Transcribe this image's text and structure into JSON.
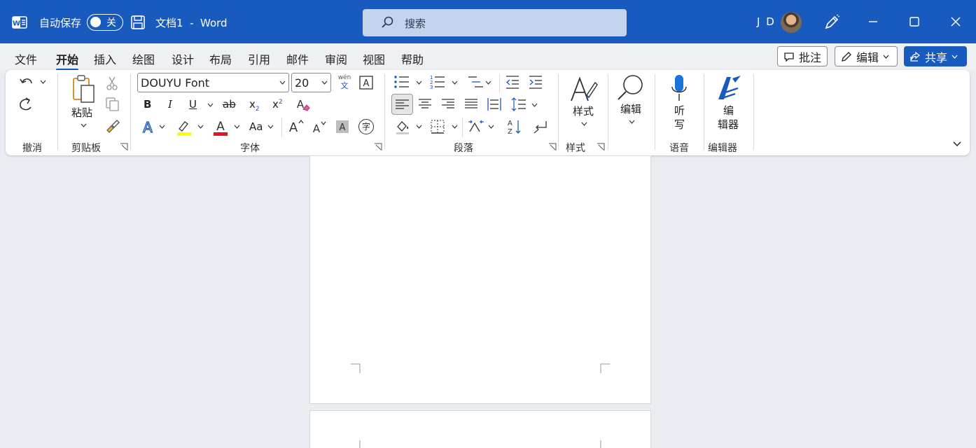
{
  "titlebar": {
    "autosave_label": "自动保存",
    "autosave_state": "关",
    "doc_title": "文档1  -  Word",
    "search_placeholder": "搜索",
    "user_initials": "J D"
  },
  "menu": {
    "tabs": [
      "文件",
      "开始",
      "插入",
      "绘图",
      "设计",
      "布局",
      "引用",
      "邮件",
      "审阅",
      "视图",
      "帮助"
    ],
    "active_tab": "开始",
    "comment_label": "批注",
    "edit_label": "编辑",
    "share_label": "共享"
  },
  "ribbon": {
    "groups": {
      "undo": "撤消",
      "clipboard": "剪贴板",
      "font": "字体",
      "paragraph": "段落",
      "styles": "样式",
      "voice": "语音",
      "editor": "编辑器"
    },
    "paste_label": "粘贴",
    "font_name": "DOUYU Font",
    "font_size": "20",
    "styles_label": "样式",
    "editing_label": "编辑",
    "dictate_label_1": "听",
    "dictate_label_2": "写",
    "editor_label_1": "编",
    "editor_label_2": "辑器",
    "phonetic_top": "wén",
    "phonetic_bottom": "文",
    "bold": "B",
    "italic": "I",
    "underline": "U",
    "strike": "ab",
    "sub": "x",
    "sup": "x",
    "change_case": "Aa",
    "enclose": "字"
  },
  "colors": {
    "accent": "#185abd",
    "highlight": "#ffff00",
    "font_color": "#e81123"
  }
}
